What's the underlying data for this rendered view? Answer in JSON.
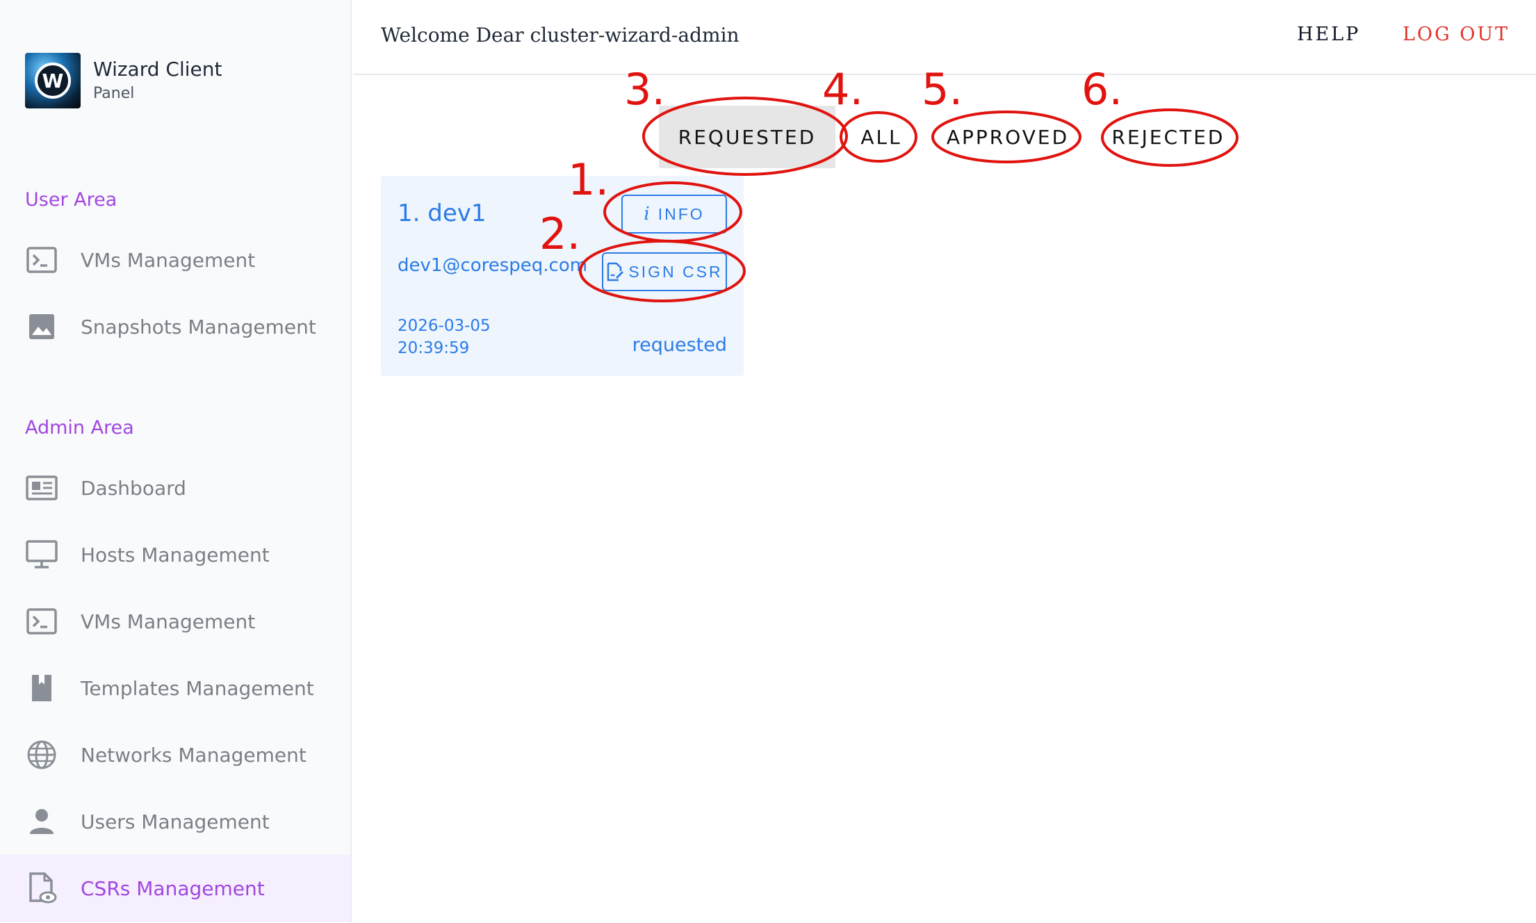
{
  "brand": {
    "title": "Wizard Client",
    "subtitle": "Panel",
    "logo_letter": "W"
  },
  "header": {
    "welcome": "Welcome Dear cluster-wizard-admin",
    "help": "HELP",
    "logout": "LOG OUT"
  },
  "sidebar": {
    "user_area_title": "User Area",
    "user_items": [
      {
        "label": "VMs Management",
        "icon": "terminal-icon"
      },
      {
        "label": "Snapshots Management",
        "icon": "image-icon"
      }
    ],
    "admin_area_title": "Admin Area",
    "admin_items": [
      {
        "label": "Dashboard",
        "icon": "dashboard-icon"
      },
      {
        "label": "Hosts Management",
        "icon": "monitor-icon"
      },
      {
        "label": "VMs Management",
        "icon": "terminal-icon"
      },
      {
        "label": "Templates Management",
        "icon": "bookmark-icon"
      },
      {
        "label": "Networks Management",
        "icon": "globe-icon"
      },
      {
        "label": "Users Management",
        "icon": "user-icon"
      },
      {
        "label": "CSRs Management",
        "icon": "file-eye-icon",
        "active": true
      }
    ]
  },
  "tabs": [
    {
      "label": "REQUESTED",
      "active": true
    },
    {
      "label": "ALL"
    },
    {
      "label": "APPROVED"
    },
    {
      "label": "REJECTED"
    }
  ],
  "csr_card": {
    "title": "1. dev1",
    "email": "dev1@corespeq.com",
    "date": "2026-03-05",
    "time": "20:39:59",
    "status": "requested",
    "info_button": "INFO",
    "info_glyph": "i",
    "sign_button": "SIGN CSR"
  },
  "annotations": [
    "1.",
    "2.",
    "3.",
    "4.",
    "5.",
    "6."
  ],
  "colors": {
    "accent_purple": "#a047e0",
    "link_blue": "#2b7be6",
    "logout_red": "#e0342b",
    "annotation_red": "#e0130f",
    "card_bg": "#eef5fd",
    "active_tab_bg": "#e6e6e6"
  }
}
